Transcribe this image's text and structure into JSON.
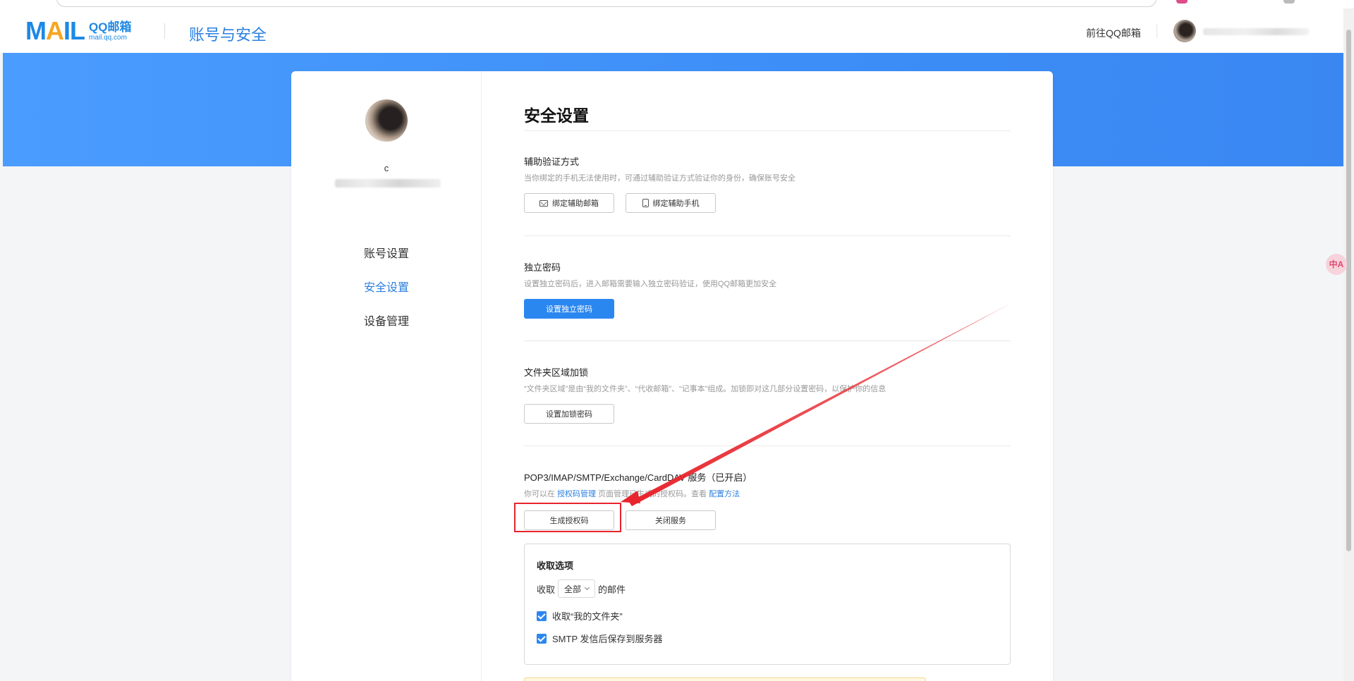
{
  "header": {
    "logo_mail": "MAIL",
    "logo_qq": "QQ邮箱",
    "logo_domain": "mail.qq.com",
    "title": "账号与安全",
    "goto_qq_mail": "前往QQ邮箱"
  },
  "sidebar": {
    "user_initial": "c",
    "items": [
      {
        "label": "账号设置",
        "active": false
      },
      {
        "label": "安全设置",
        "active": true
      },
      {
        "label": "设备管理",
        "active": false
      }
    ]
  },
  "main": {
    "page_title": "安全设置",
    "sections": {
      "aux_verify": {
        "title": "辅助验证方式",
        "desc": "当你绑定的手机无法使用时，可通过辅助验证方式验证你的身份，确保账号安全",
        "btn_bind_email": "绑定辅助邮箱",
        "btn_bind_phone": "绑定辅助手机"
      },
      "independent_password": {
        "title": "独立密码",
        "desc": "设置独立密码后，进入邮箱需要输入独立密码验证，使用QQ邮箱更加安全",
        "btn_set": "设置独立密码"
      },
      "folder_lock": {
        "title": "文件夹区域加锁",
        "desc": "“文件夹区域”是由“我的文件夹”、“代收邮箱”、“记事本”组成。加锁即对这几部分设置密码，以保护你的信息",
        "btn_set": "设置加锁密码"
      },
      "pop3": {
        "title": "POP3/IMAP/SMTP/Exchange/CardDAV 服务（已开启）",
        "desc_prefix": "你可以在",
        "desc_link1": "授权码管理",
        "desc_middle": "页面管理已生成的授权码。查看",
        "desc_link2": "配置方法",
        "btn_generate": "生成授权码",
        "btn_close": "关闭服务"
      }
    },
    "receive_options": {
      "title": "收取选项",
      "receive_prefix": "收取",
      "receive_select": "全部",
      "receive_suffix": "的邮件",
      "check_my_folders": "收取“我的文件夹”",
      "check_smtp_save": "SMTP 发信后保存到服务器"
    }
  },
  "colors": {
    "accent": "#2b87f0",
    "band": "#3d8ef7",
    "annotation": "#e8242c"
  },
  "icons": {
    "bind_email": "mail-icon",
    "bind_phone": "phone-icon",
    "select": "chevron-down-icon",
    "checkbox": "check-icon",
    "translate": "translate-icon"
  },
  "float_btn": "中A"
}
